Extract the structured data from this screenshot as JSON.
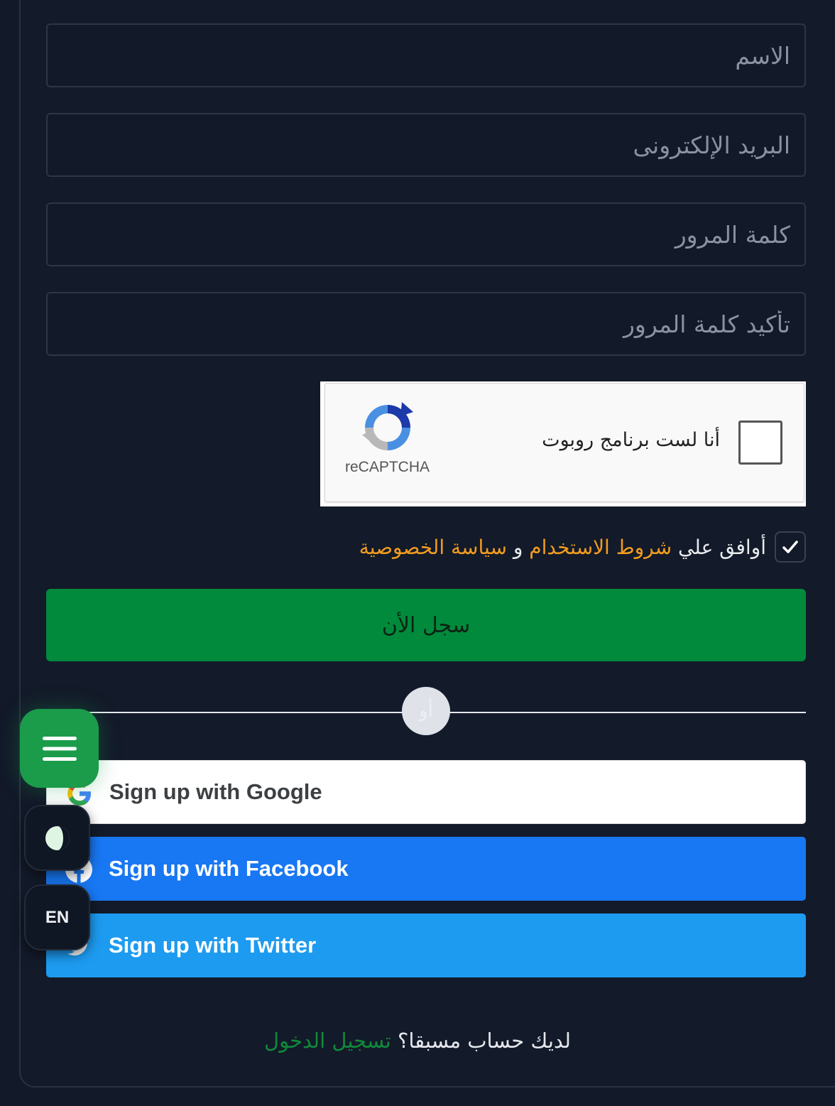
{
  "form": {
    "name_placeholder": "الاسم",
    "email_placeholder": "البريد الإلكترونى",
    "password_placeholder": "كلمة المرور",
    "confirm_password_placeholder": "تأكيد كلمة المرور"
  },
  "captcha": {
    "label": "أنا لست برنامج روبوت",
    "brand": "reCAPTCHA",
    "checked": false
  },
  "agree": {
    "prefix": "أوافق علي",
    "terms_link": "شروط الاستخدام",
    "connector": "و",
    "privacy_link": "سياسة الخصوصية",
    "checked": true
  },
  "submit_label": "سجل الأن",
  "divider_label": "أو",
  "social": {
    "google_label": "Sign up with Google",
    "facebook_label": "Sign up with Facebook",
    "twitter_label": "Sign up with Twitter"
  },
  "login": {
    "prompt": "لديك حساب مسبقا؟",
    "link": "تسجيل الدخول"
  },
  "floating": {
    "lang_label": "EN"
  },
  "colors": {
    "background": "#121929",
    "primary_green": "#018a3c",
    "link_orange": "#f29c1f",
    "facebook_blue": "#1877f2",
    "twitter_blue": "#1d9bf0"
  },
  "icons": [
    "menu-icon",
    "theme-toggle-icon",
    "google-icon",
    "facebook-icon",
    "twitter-icon",
    "recaptcha-logo-icon",
    "check-icon"
  ]
}
